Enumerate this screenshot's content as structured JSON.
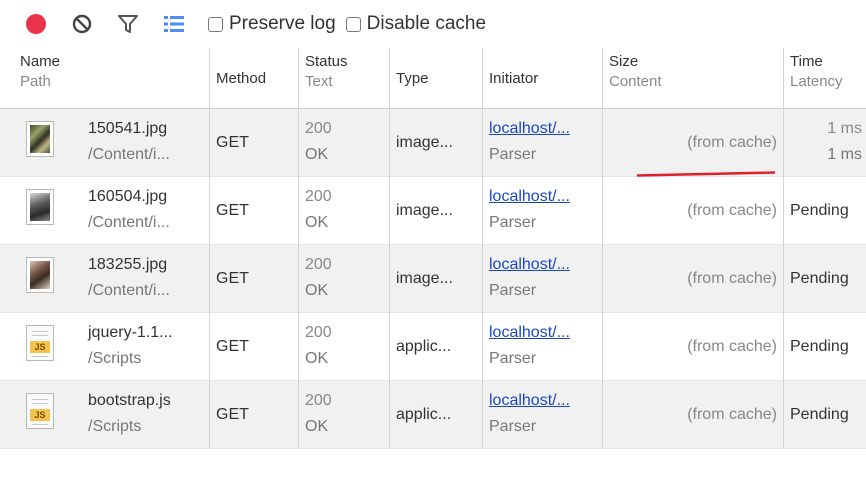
{
  "toolbar": {
    "record_icon": "record-dot-icon",
    "clear_icon": "clear-icon",
    "filter_icon": "filter-icon",
    "list_icon": "list-view-icon",
    "preserve_log_label": "Preserve log",
    "disable_cache_label": "Disable cache",
    "record_color": "#e8334a",
    "list_icon_color": "#4a8ef0"
  },
  "columns": {
    "name": {
      "title": "Name",
      "sub": "Path"
    },
    "method": {
      "title": "Method"
    },
    "status": {
      "title": "Status",
      "sub": "Text"
    },
    "type": {
      "title": "Type"
    },
    "initiator": {
      "title": "Initiator"
    },
    "size": {
      "title": "Size",
      "sub": "Content"
    },
    "time": {
      "title": "Time",
      "sub": "Latency"
    }
  },
  "rows": [
    {
      "name": "150541.jpg",
      "path": "/Content/i...",
      "method": "GET",
      "status": "200",
      "status_text": "OK",
      "type": "image...",
      "initiator": "localhost/...",
      "initiator_sub": "Parser",
      "size": "(from cache)",
      "time": "1 ms",
      "latency": "1 ms",
      "thumb": "photo-thumbnail-icon"
    },
    {
      "name": "160504.jpg",
      "path": "/Content/i...",
      "method": "GET",
      "status": "200",
      "status_text": "OK",
      "type": "image...",
      "initiator": "localhost/...",
      "initiator_sub": "Parser",
      "size": "(from cache)",
      "time": "Pending",
      "thumb": "photo-thumbnail-icon"
    },
    {
      "name": "183255.jpg",
      "path": "/Content/i...",
      "method": "GET",
      "status": "200",
      "status_text": "OK",
      "type": "image...",
      "initiator": "localhost/...",
      "initiator_sub": "Parser",
      "size": "(from cache)",
      "time": "Pending",
      "thumb": "photo-thumbnail-icon"
    },
    {
      "name": "jquery-1.1...",
      "path": "/Scripts",
      "method": "GET",
      "status": "200",
      "status_text": "OK",
      "type": "applic...",
      "initiator": "localhost/...",
      "initiator_sub": "Parser",
      "size": "(from cache)",
      "time": "Pending",
      "thumb": "js-file-icon",
      "badge": "JS"
    },
    {
      "name": "bootstrap.js",
      "path": "/Scripts",
      "method": "GET",
      "status": "200",
      "status_text": "OK",
      "type": "applic...",
      "initiator": "localhost/...",
      "initiator_sub": "Parser",
      "size": "(from cache)",
      "time": "Pending",
      "thumb": "js-file-icon",
      "badge": "JS"
    }
  ],
  "annotation_color": "#e0202a"
}
